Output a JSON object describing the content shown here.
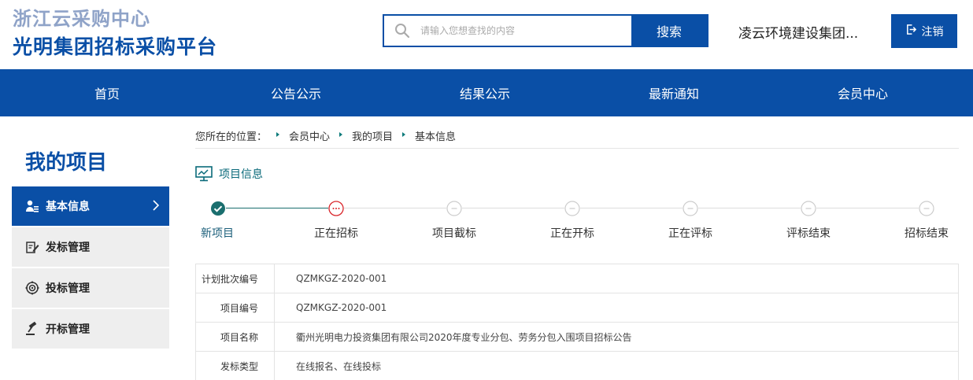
{
  "header": {
    "logo_line1": "浙江云采购中心",
    "logo_line2": "光明集团招标采购平台",
    "search_placeholder": "请输入您想查找的内容",
    "search_button": "搜索",
    "user_name": "凌云环境建设集团...",
    "logout_label": "注销"
  },
  "nav": {
    "items": [
      "首页",
      "公告公示",
      "结果公示",
      "最新通知",
      "会员中心"
    ]
  },
  "sidebar": {
    "title": "我的项目",
    "items": [
      {
        "label": "基本信息",
        "icon": "user-list-icon",
        "active": true
      },
      {
        "label": "发标管理",
        "icon": "edit-icon",
        "active": false
      },
      {
        "label": "投标管理",
        "icon": "target-icon",
        "active": false
      },
      {
        "label": "开标管理",
        "icon": "gavel-icon",
        "active": false
      }
    ]
  },
  "breadcrumb": {
    "prefix": "您所在的位置：",
    "items": [
      "会员中心",
      "我的项目",
      "基本信息"
    ]
  },
  "section": {
    "title": "项目信息"
  },
  "steps": {
    "items": [
      {
        "label": "新项目",
        "state": "done"
      },
      {
        "label": "正在招标",
        "state": "current"
      },
      {
        "label": "项目截标",
        "state": "pending"
      },
      {
        "label": "正在开标",
        "state": "pending"
      },
      {
        "label": "正在评标",
        "state": "pending"
      },
      {
        "label": "评标结束",
        "state": "pending"
      },
      {
        "label": "招标结束",
        "state": "pending"
      }
    ]
  },
  "info": {
    "rows": [
      {
        "key": "计划批次编号",
        "value": "QZMKGZ-2020-001"
      },
      {
        "key": "项目编号",
        "value": "QZMKGZ-2020-001"
      },
      {
        "key": "项目名称",
        "value": "衢州光明电力投资集团有限公司2020年度专业分包、劳务分包入围项目招标公告"
      },
      {
        "key": "发标类型",
        "value": "在线报名、在线投标"
      }
    ]
  },
  "colors": {
    "brand": "#0a4fa6",
    "done": "#1a6e6e",
    "current": "#d9262b",
    "pending": "#cccccc"
  }
}
